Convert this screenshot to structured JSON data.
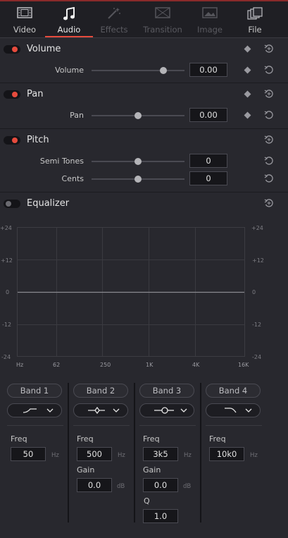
{
  "tabs": [
    {
      "label": "Video",
      "icon": "film-icon",
      "state": "normal"
    },
    {
      "label": "Audio",
      "icon": "music-note-icon",
      "state": "active"
    },
    {
      "label": "Effects",
      "icon": "magic-wand-icon",
      "state": "disabled"
    },
    {
      "label": "Transition",
      "icon": "transition-icon",
      "state": "disabled"
    },
    {
      "label": "Image",
      "icon": "image-icon",
      "state": "disabled"
    },
    {
      "label": "File",
      "icon": "file-stack-icon",
      "state": "normal"
    }
  ],
  "volume": {
    "title": "Volume",
    "enabled": true,
    "param_label": "Volume",
    "value": "0.00",
    "slider_fraction": 0.77
  },
  "pan": {
    "title": "Pan",
    "enabled": true,
    "param_label": "Pan",
    "value": "0.00",
    "slider_fraction": 0.5
  },
  "pitch": {
    "title": "Pitch",
    "enabled": true,
    "semitones_label": "Semi Tones",
    "semitones_value": "0",
    "semitones_fraction": 0.5,
    "cents_label": "Cents",
    "cents_value": "0",
    "cents_fraction": 0.5
  },
  "equalizer": {
    "title": "Equalizer",
    "enabled": false,
    "db_ticks": [
      "+24",
      "+12",
      "0",
      "-12",
      "-24"
    ],
    "freq_ticks": [
      "Hz",
      "62",
      "250",
      "1K",
      "4K",
      "16K"
    ],
    "bands": [
      {
        "label": "Band 1",
        "filter_icon": "high-pass-icon",
        "freq_label": "Freq",
        "freq": "50",
        "freq_unit": "Hz"
      },
      {
        "label": "Band 2",
        "filter_icon": "bell-icon",
        "freq_label": "Freq",
        "freq": "500",
        "freq_unit": "Hz",
        "gain_label": "Gain",
        "gain": "0.0",
        "gain_unit": "dB"
      },
      {
        "label": "Band 3",
        "filter_icon": "notch-icon",
        "freq_label": "Freq",
        "freq": "3k5",
        "freq_unit": "Hz",
        "gain_label": "Gain",
        "gain": "0.0",
        "gain_unit": "dB",
        "q_label": "Q",
        "q": "1.0"
      },
      {
        "label": "Band 4",
        "filter_icon": "low-pass-icon",
        "freq_label": "Freq",
        "freq": "10k0",
        "freq_unit": "Hz"
      }
    ]
  },
  "colors": {
    "accent": "#e64b3d",
    "panel": "#28282e"
  }
}
